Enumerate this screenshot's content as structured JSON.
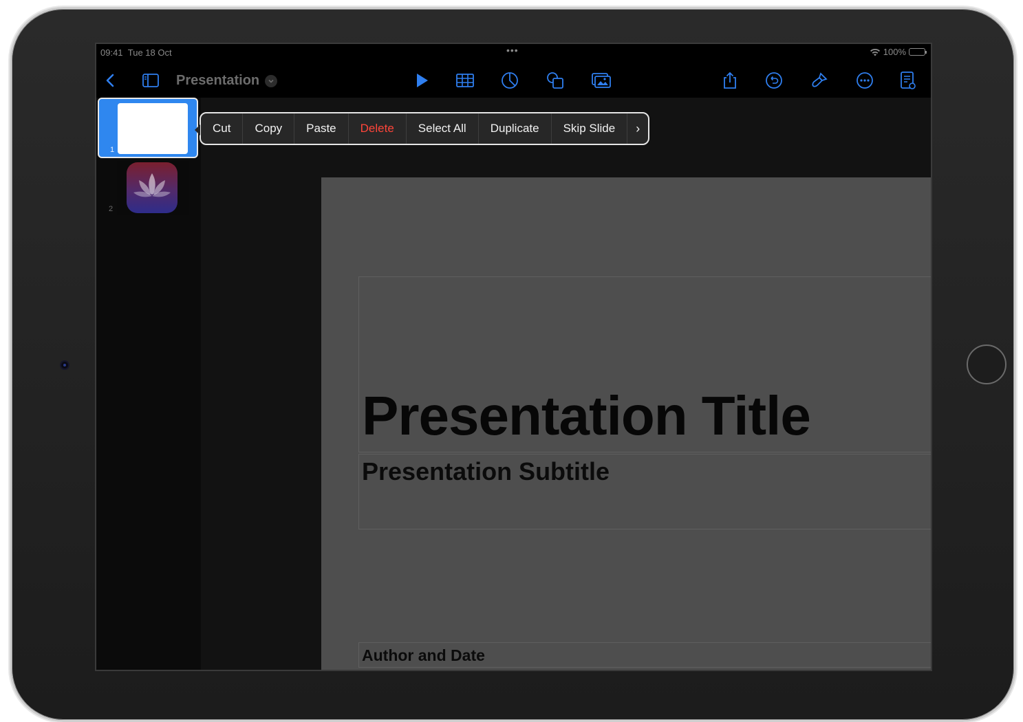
{
  "status_bar": {
    "time": "09:41",
    "date": "Tue 18 Oct",
    "dots": "•••",
    "battery": "100%"
  },
  "toolbar": {
    "doc_title": "Presentation",
    "icons": {
      "back": "chevron-left-icon",
      "sidebar": "sidebar-icon",
      "title_menu": "chevron-down-icon",
      "play": "play-icon",
      "table": "table-icon",
      "chart": "chart-icon",
      "shapes": "shapes-icon",
      "media": "media-icon",
      "share": "share-icon",
      "undo": "undo-icon",
      "format": "paintbrush-icon",
      "more": "ellipsis-icon",
      "document": "document-icon"
    },
    "accent_color": "#2f7ff0"
  },
  "sidebar": {
    "slides": [
      {
        "number": "1",
        "selected": true
      },
      {
        "number": "2",
        "selected": false
      }
    ],
    "add_button": "+"
  },
  "context_menu": {
    "items": [
      "Cut",
      "Copy",
      "Paste",
      "Delete",
      "Select All",
      "Duplicate",
      "Skip Slide"
    ],
    "more": "›",
    "danger_color": "#ff453a"
  },
  "slide": {
    "title": "Presentation Title",
    "subtitle": "Presentation Subtitle",
    "author": "Author and Date"
  }
}
